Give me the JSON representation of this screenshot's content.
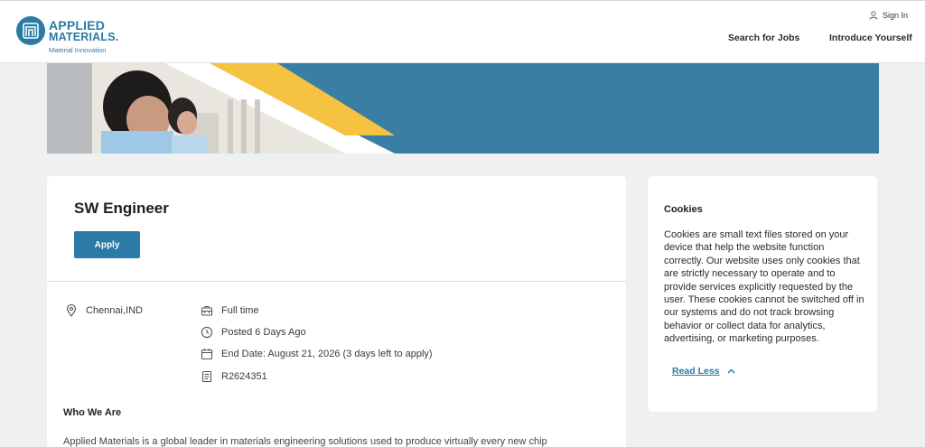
{
  "brand": {
    "line1": "APPLIED",
    "line2": "MATERIALS.",
    "tagline": "Material Innovation"
  },
  "header": {
    "sign_in": "Sign In",
    "nav": [
      "Search for Jobs",
      "Introduce Yourself"
    ]
  },
  "job": {
    "title": "SW Engineer",
    "apply_label": "Apply",
    "location": "Chennai,IND",
    "details": [
      {
        "icon": "briefcase-icon",
        "text": "Full time"
      },
      {
        "icon": "clock-icon",
        "text": "Posted 6 Days Ago"
      },
      {
        "icon": "calendar-icon",
        "text": "End Date: August 21, 2026 (3 days left to apply)"
      },
      {
        "icon": "document-icon",
        "text": "R2624351"
      }
    ],
    "section_heading": "Who We Are",
    "section_text_partial": "Applied Materials is a global leader in materials engineering solutions used to produce virtually every new chip"
  },
  "cookies": {
    "title": "Cookies",
    "body": "Cookies are small text files stored on your device that help the website function correctly. Our website uses only cookies that are strictly necessary to operate and to provide services explicitly requested by the user. These cookies cannot be switched off in our systems and do not track browsing behavior or collect data for analytics, advertising, or marketing purposes.",
    "read_less": "Read Less"
  },
  "colors": {
    "accent": "#2c7aa6",
    "hero_blue": "#3a7fa3",
    "hero_yellow": "#f5c242",
    "background": "#eef0f1"
  }
}
